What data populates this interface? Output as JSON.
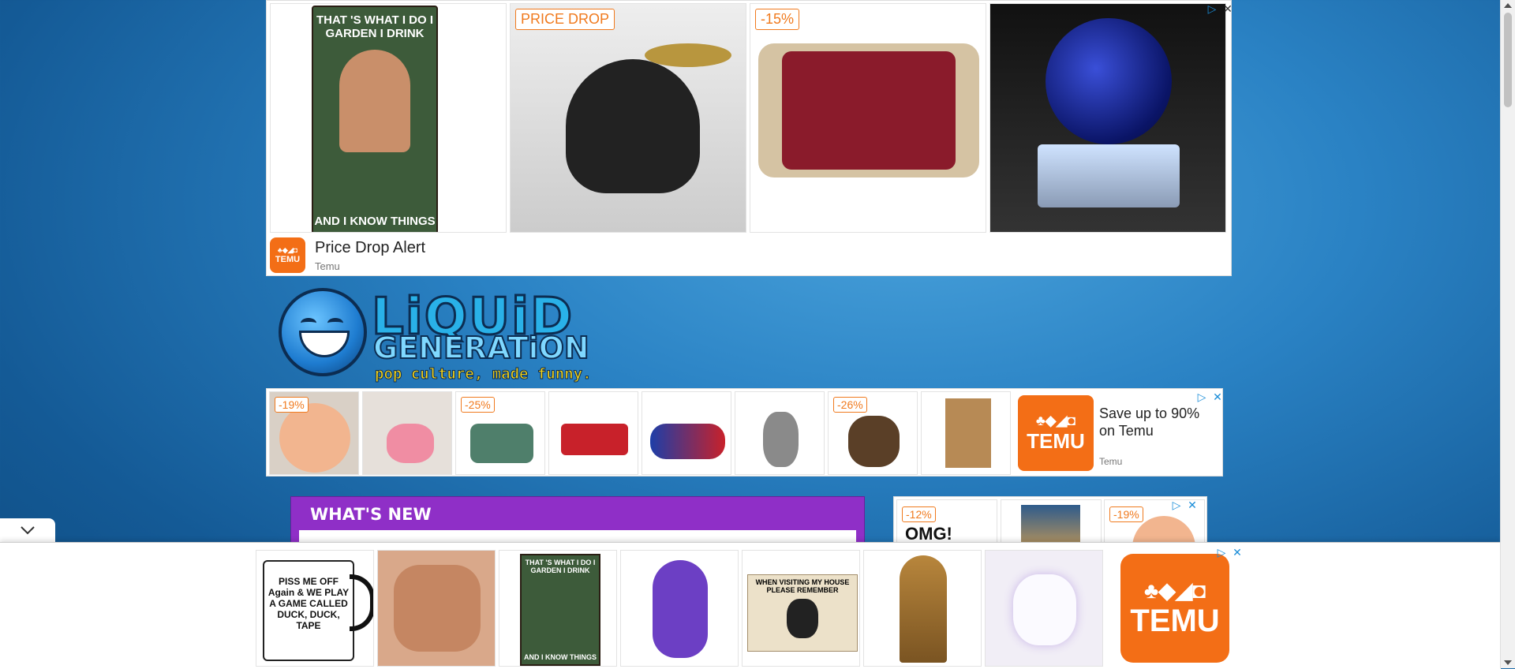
{
  "top_ad": {
    "badges": [
      "PRICE DROP",
      "-15%"
    ],
    "sign_text_top": "THAT 'S WHAT I DO I GARDEN I DRINK",
    "sign_text_bottom": "AND I KNOW THINGS",
    "title": "Price Drop Alert",
    "advertiser": "Temu",
    "logo_text": "TEMU"
  },
  "site": {
    "logo_word1": "LiQUiD",
    "logo_word2": "GENERATiON",
    "tagline": "pop culture, made funny."
  },
  "mid_ad": {
    "badges": [
      "-19%",
      "-25%",
      "-26%"
    ],
    "headline": "Save up to 90% on Temu",
    "advertiser": "Temu",
    "logo_text": "TEMU"
  },
  "section": {
    "title": "WHAT'S NEW"
  },
  "side_ad": {
    "badges": [
      "-12%",
      "-19%"
    ],
    "mug_text": "OMG!"
  },
  "anchor_ad": {
    "mug_text": "PISS ME OFF Again & WE PLAY A GAME CALLED DUCK, DUCK, TAPE",
    "sign_text_top": "THAT 'S WHAT I DO I GARDEN I DRINK",
    "sign_text_bottom": "AND I KNOW THINGS",
    "cat_sign_title": "WHEN VISITING MY HOUSE PLEASE REMEMBER",
    "logo_text": "TEMU"
  },
  "colors": {
    "temu_orange": "#f36e16",
    "badge_orange": "#f07a1e",
    "section_purple": "#8f2fc7",
    "adchoices_blue": "#1a8dd8"
  },
  "icons": [
    "adchoices-icon",
    "close-icon",
    "chevron-down-icon"
  ]
}
